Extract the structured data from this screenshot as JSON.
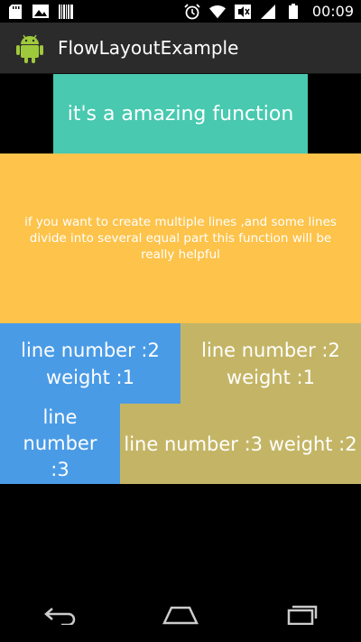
{
  "status_bar": {
    "time": "00:09",
    "left_icons": [
      "sd-card-icon",
      "photo-icon",
      "barcode-icon"
    ],
    "right_icons": [
      "alarm-icon",
      "wifi-icon",
      "mute-icon",
      "signal-icon",
      "battery-icon"
    ]
  },
  "action_bar": {
    "title": "FlowLayoutExample",
    "icon": "android-icon"
  },
  "blocks": {
    "top": "it's a amazing function",
    "description": "if you want to create multiple lines ,and some lines divide into several equal part this function will be really helpful",
    "line2_a": "line number :2 weight :1",
    "line2_b": "line number :2 weight :1",
    "line3_a": "line number :3",
    "line3_b": "line number :3 weight :2"
  },
  "colors": {
    "teal": "#48c9b0",
    "yellow": "#fdc34a",
    "blue": "#4a9be6",
    "olive": "#c4b566"
  },
  "navigation": [
    "back-icon",
    "home-icon",
    "recents-icon"
  ]
}
